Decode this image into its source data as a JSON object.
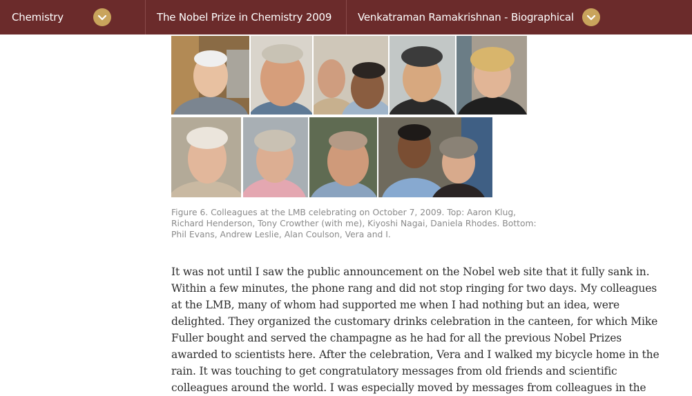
{
  "nav": {
    "breadcrumb": [
      {
        "label": "Chemistry",
        "has_dropdown": true
      },
      {
        "label": "The Nobel Prize in Chemistry 2009",
        "has_dropdown": false
      },
      {
        "label": "Venkatraman Ramakrishnan - Biographical",
        "has_dropdown": true
      }
    ],
    "dropdown_icon": "chevron-down-icon",
    "colors": {
      "bar": "#6b2b2b",
      "chevron_bg": "#c9a45c",
      "text": "#ffffff"
    }
  },
  "figure": {
    "photos_top": [
      {
        "person": "Aaron Klug"
      },
      {
        "person": "Richard Henderson"
      },
      {
        "person": "Tony Crowther (with me)"
      },
      {
        "person": "Kiyoshi Nagai"
      },
      {
        "person": "Daniela Rhodes"
      }
    ],
    "photos_bottom": [
      {
        "person": "Phil Evans"
      },
      {
        "person": "Andrew Leslie"
      },
      {
        "person": "Alan Coulson"
      },
      {
        "person": "Vera and I"
      }
    ],
    "caption_lines": [
      "Figure 6. Colleagues at the LMB celebrating on October 7, 2009. Top: Aaron Klug,",
      "Richard Henderson, Tony Crowther (with me), Kiyoshi Nagai, Daniela Rhodes. Bottom:",
      "Phil Evans, Andrew Leslie, Alan Coulson, Vera and I."
    ]
  },
  "article": {
    "paragraph_lines": [
      "It was not until I saw the public announcement on the Nobel web site that it fully sank in.",
      "Within a few minutes, the phone rang and did not stop ringing for two days. My colleagues",
      "at the LMB, many of whom had supported me when I had nothing but an idea, were",
      "delighted. They organized the customary drinks celebration in the canteen, for which Mike",
      "Fuller bought and served the champagne as he had for all the previous Nobel Prizes",
      "awarded to scientists here. After the celebration, Vera and I walked my bicycle home in the",
      "rain. It was touching to get congratulatory messages from old friends and scientific",
      "colleagues around the world. I was especially moved by messages from colleagues in the"
    ]
  }
}
